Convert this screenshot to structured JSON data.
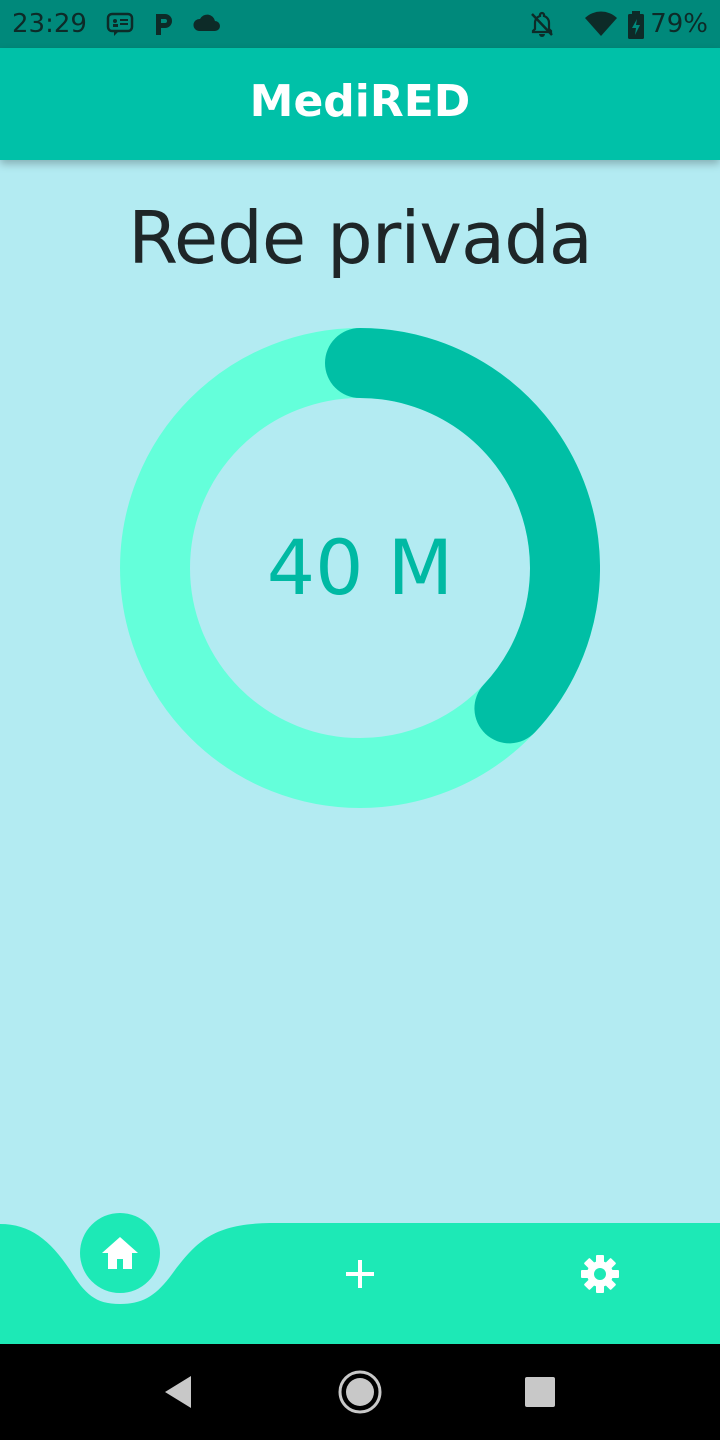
{
  "status_bar": {
    "time": "23:29",
    "battery_text": "79%",
    "icons": [
      "message-icon",
      "parking-icon",
      "cloud-icon",
      "notifications-off-icon",
      "wifi-icon",
      "battery-charging-icon"
    ]
  },
  "app_bar": {
    "title": "MediRED"
  },
  "main": {
    "heading": "Rede privada",
    "gauge": {
      "value_text": "40 M",
      "progress_fraction": 0.37,
      "track_color": "#64ffda",
      "progress_color": "#00bfa5"
    }
  },
  "bottom_nav": {
    "items": [
      {
        "icon": "home-icon",
        "selected": true
      },
      {
        "icon": "add-icon",
        "selected": false
      },
      {
        "icon": "settings-icon",
        "selected": false
      }
    ],
    "color": "#1de9b6"
  },
  "system_nav": {
    "buttons": [
      "back-icon",
      "home-circle-icon",
      "recents-icon"
    ]
  }
}
